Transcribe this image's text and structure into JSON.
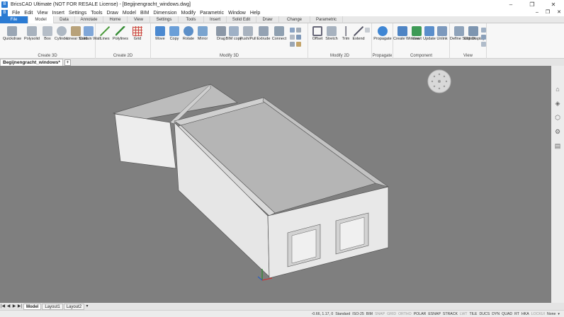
{
  "window": {
    "title": "BricsCAD Ultimate (NOT FOR RESALE License) - [Begijnengracht_windows.dwg]",
    "app_icon": "B",
    "controls": [
      "–",
      "❐",
      "✕"
    ]
  },
  "menubar": {
    "items": [
      "File",
      "Edit",
      "View",
      "Insert",
      "Settings",
      "Tools",
      "Draw",
      "Model",
      "BIM",
      "Dimension",
      "Modify",
      "Parametric",
      "Window",
      "Help"
    ],
    "right_controls": [
      "–",
      "❐",
      "✕"
    ]
  },
  "ribbon_tabs": [
    "File",
    "Model",
    "Data",
    "Annotate",
    "Home",
    "View",
    "Settings",
    "Tools",
    "Insert",
    "Solid Edit",
    "Draw",
    "Change",
    "Parametric"
  ],
  "ribbon": {
    "panels": [
      {
        "title": "Create 3D",
        "tools": [
          "Quickdraw",
          "Polysolid",
          "Box",
          "Cylinder",
          "Linear Solid",
          "Curtain Wall"
        ]
      },
      {
        "title": "Create 2D",
        "tools": [
          "Lines",
          "Polylines",
          "Grid"
        ]
      },
      {
        "title": "Modify 3D",
        "tools": [
          "Move",
          "Copy",
          "Rotate",
          "Mirror",
          "Drag",
          "BIM copy",
          "Push/Pull",
          "Extrude",
          "Connect"
        ]
      },
      {
        "title": "Modify 2D",
        "tools": [
          "Offset",
          "Stretch",
          "Trim",
          "Extend"
        ]
      },
      {
        "title": "Propagate",
        "tools": [
          "Propagate"
        ]
      },
      {
        "title": "Component",
        "tools": [
          "Create Window",
          "Insert",
          "Update",
          "Unlink"
        ]
      },
      {
        "title": "View",
        "tools": [
          "Define Section",
          "Clip Display"
        ]
      }
    ]
  },
  "document_tab": {
    "label": "Begijnengracht_windows*",
    "add": "+"
  },
  "sidebar_icons": [
    "structure-icon",
    "layers-icon",
    "3d-box-icon",
    "settings-icon",
    "properties-icon"
  ],
  "layout_tabs": {
    "nav": [
      "|◀",
      "◀",
      "▶",
      "▶|"
    ],
    "tabs": [
      "Model",
      "Layout1",
      "Layout2"
    ],
    "active": "Model",
    "dropdown": "▾"
  },
  "statusbar": {
    "coords": "-0.66, 1.17, 0",
    "items": [
      {
        "label": "Standard",
        "on": true
      },
      {
        "label": "ISO-25",
        "on": true
      },
      {
        "label": "BIM",
        "on": true
      },
      {
        "label": "SNAP",
        "on": false
      },
      {
        "label": "GRID",
        "on": false
      },
      {
        "label": "ORTHO",
        "on": false
      },
      {
        "label": "POLAR",
        "on": true
      },
      {
        "label": "ESNAP",
        "on": true
      },
      {
        "label": "STRACK",
        "on": true
      },
      {
        "label": "LWT",
        "on": false
      },
      {
        "label": "TILE",
        "on": true
      },
      {
        "label": "DUCS",
        "on": true
      },
      {
        "label": "DYN",
        "on": true
      },
      {
        "label": "QUAD",
        "on": true
      },
      {
        "label": "RT",
        "on": true
      },
      {
        "label": "HKA",
        "on": true
      },
      {
        "label": "LOCKUI",
        "on": false
      },
      {
        "label": "None",
        "on": true
      }
    ]
  },
  "colors": {
    "accent": "#2b7bd3",
    "viewport": "#7f7f7f",
    "model_face": "#e8e8e8"
  }
}
